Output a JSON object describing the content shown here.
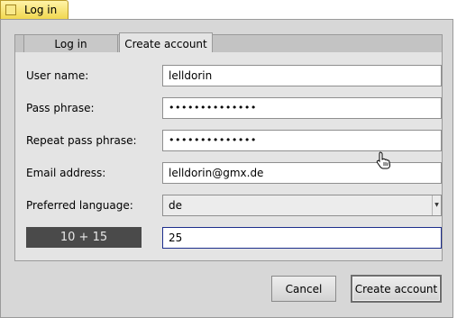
{
  "window": {
    "title": "Log in"
  },
  "tabs": [
    {
      "label": "Log in",
      "active": false
    },
    {
      "label": "Create account",
      "active": true
    }
  ],
  "form": {
    "username": {
      "label": "User name:",
      "value": "lelldorin"
    },
    "passphrase": {
      "label": "Pass phrase:",
      "value": "••••••••••••••"
    },
    "repeat": {
      "label": "Repeat pass phrase:",
      "value": "••••••••••••••"
    },
    "email": {
      "label": "Email address:",
      "value": "lelldorin@gmx.de"
    },
    "language": {
      "label": "Preferred language:",
      "selected": "de"
    },
    "captcha": {
      "challenge": "10 + 15",
      "answer": "25"
    }
  },
  "buttons": {
    "cancel": "Cancel",
    "create": "Create account"
  },
  "icons": {
    "dropdown": "chevron-down-icon",
    "cursor": "hand-pointer-icon",
    "window": "window-icon"
  },
  "colors": {
    "title_tab": "#f1d850",
    "active_field_border": "#1d2e8c",
    "captcha_bg": "#4a4a4a"
  }
}
